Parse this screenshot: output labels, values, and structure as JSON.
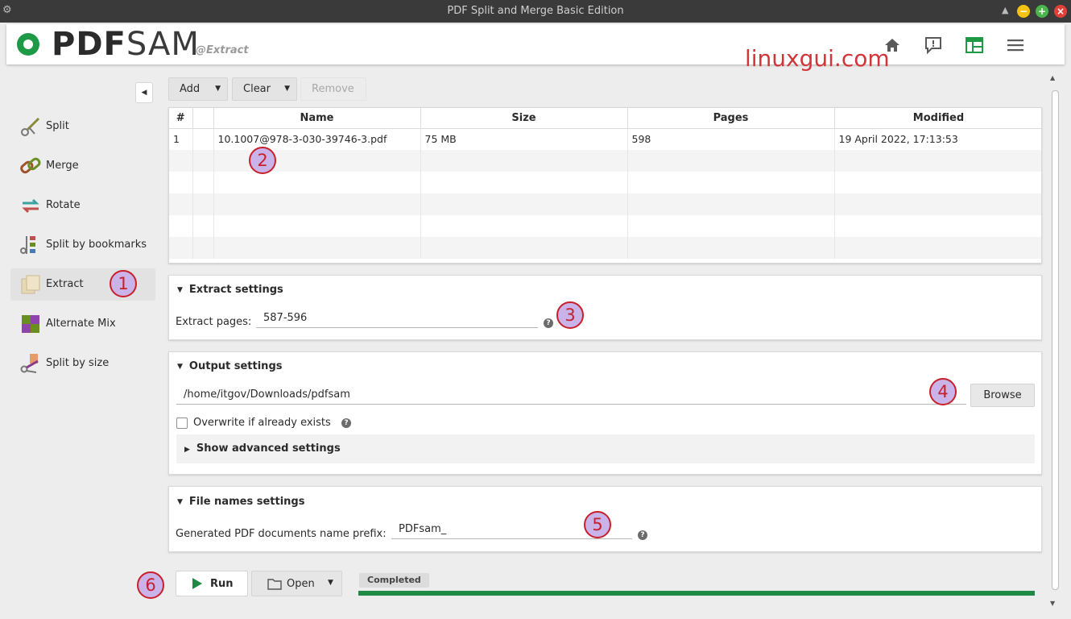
{
  "window": {
    "title": "PDF Split and Merge Basic Edition",
    "buttons": {
      "minimize": "−",
      "maximize": "+",
      "close": "×"
    }
  },
  "header": {
    "logo_text_bold": "PDF",
    "logo_text_light": "SAM",
    "module_label": "@Extract",
    "icons": [
      "home-icon",
      "feedback-icon",
      "dashboard-icon",
      "menu-icon"
    ],
    "accent_color": "#1e9a47"
  },
  "watermark": "linuxgui.com",
  "sidebar": {
    "items": [
      {
        "label": "Split",
        "icon": "scissors-icon"
      },
      {
        "label": "Merge",
        "icon": "chain-icon"
      },
      {
        "label": "Rotate",
        "icon": "rotate-icon"
      },
      {
        "label": "Split by bookmarks",
        "icon": "bookmarks-split-icon"
      },
      {
        "label": "Extract",
        "icon": "extract-icon",
        "active": true
      },
      {
        "label": "Alternate Mix",
        "icon": "alternate-mix-icon"
      },
      {
        "label": "Split by size",
        "icon": "split-size-icon"
      }
    ]
  },
  "toolbar": {
    "add": "Add",
    "clear": "Clear",
    "remove": "Remove"
  },
  "table": {
    "headers": [
      "#",
      "",
      "Name",
      "Size",
      "Pages",
      "Modified"
    ],
    "rows": [
      [
        "1",
        "",
        "10.1007@978-3-030-39746-3.pdf",
        "75 MB",
        "598",
        "19 April 2022, 17:13:53"
      ]
    ]
  },
  "extract_settings": {
    "title": "Extract settings",
    "pages_label": "Extract pages:",
    "pages_value": "587-596"
  },
  "output_settings": {
    "title": "Output settings",
    "path": "/home/itgov/Downloads/pdfsam",
    "browse": "Browse",
    "overwrite_label": "Overwrite if already exists",
    "overwrite_checked": false,
    "advanced": "Show advanced settings"
  },
  "file_names": {
    "title": "File names settings",
    "prefix_label": "Generated PDF documents name prefix:",
    "prefix_value": "PDFsam_"
  },
  "footer": {
    "run": "Run",
    "open": "Open",
    "status": "Completed",
    "progress": 1.0
  },
  "annotations": [
    "1",
    "2",
    "3",
    "4",
    "5",
    "6"
  ]
}
